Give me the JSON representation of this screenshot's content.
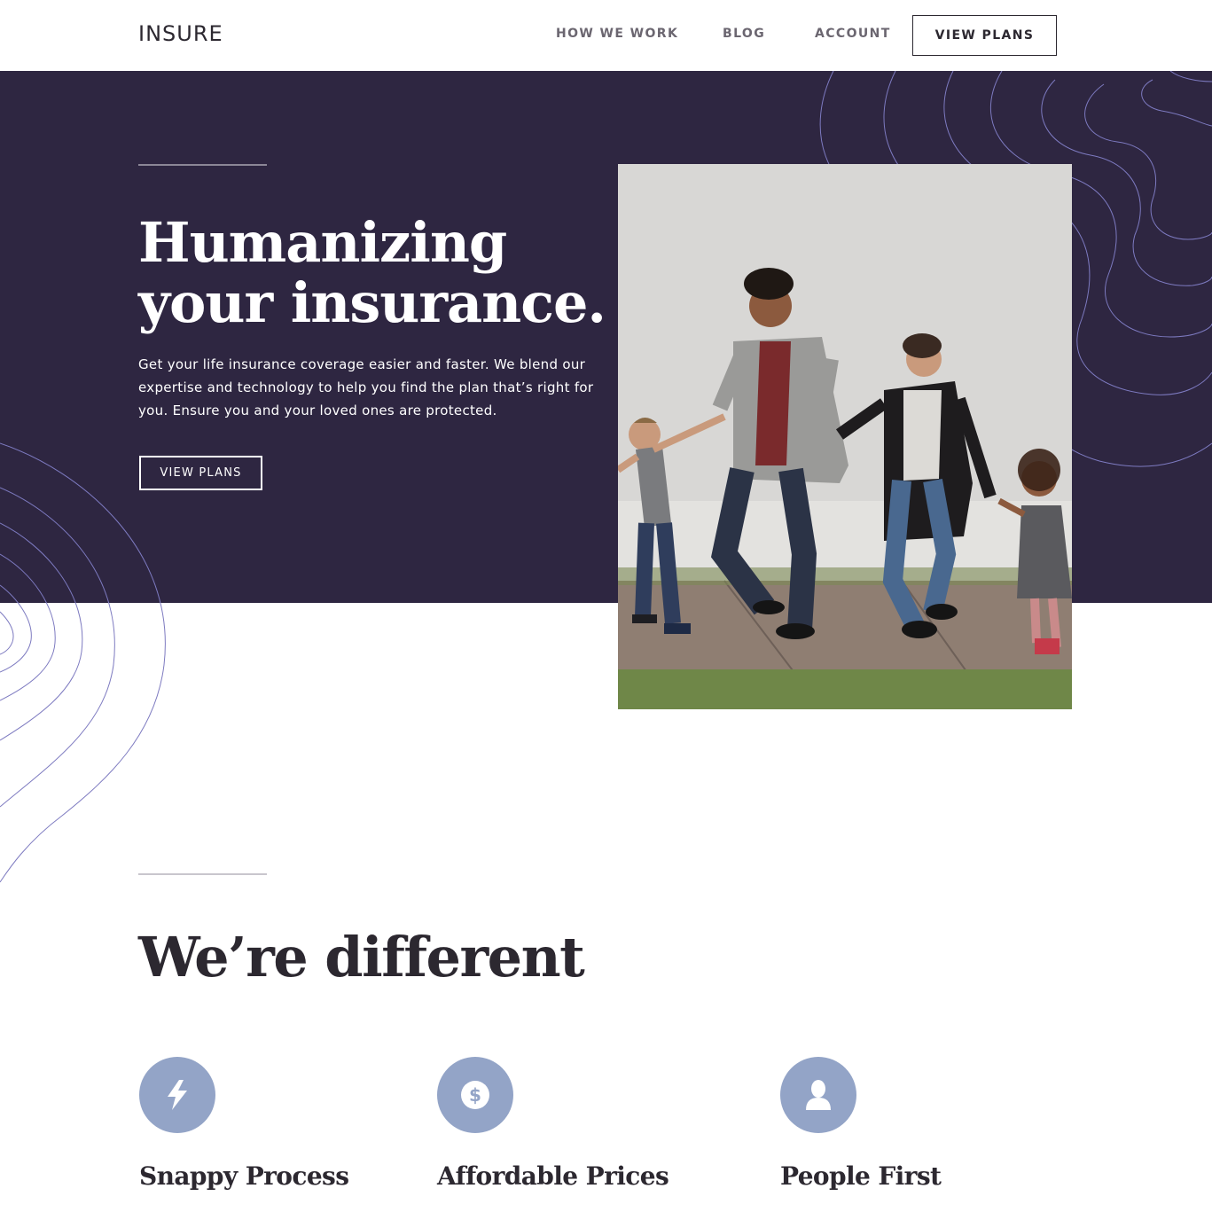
{
  "nav": {
    "logo": "INSURE",
    "links": [
      "HOW WE WORK",
      "BLOG",
      "ACCOUNT"
    ],
    "cta": "VIEW PLANS"
  },
  "hero": {
    "title_line1": "Humanizing",
    "title_line2": "your insurance.",
    "text": "Get your life insurance coverage easier and faster. We blend our expertise and technology to help you find the plan that’s right for you. Ensure you and your loved ones are protected.",
    "cta": "VIEW PLANS"
  },
  "different": {
    "title": "We’re different",
    "features": [
      {
        "title": "Snappy Process",
        "icon": "lightning-icon"
      },
      {
        "title": "Affordable Prices",
        "icon": "dollar-icon"
      },
      {
        "title": "People First",
        "icon": "person-icon"
      }
    ]
  },
  "colors": {
    "hero_bg": "#2e2641",
    "accent_icon": "#93a4c7",
    "text_dark": "#2c2830",
    "contour_lines": "#7d7ac0"
  }
}
